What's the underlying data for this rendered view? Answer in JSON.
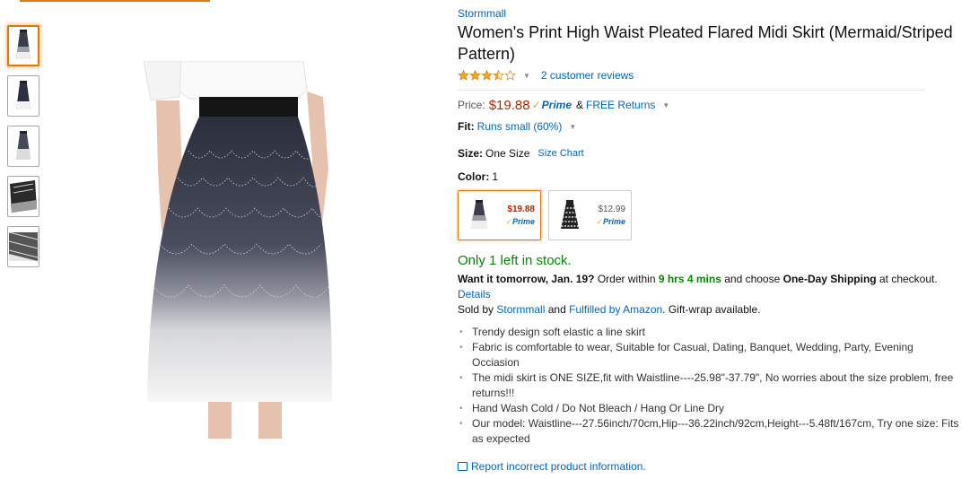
{
  "brand": "Stormmall",
  "title": "Women's Print High Waist Pleated Flared Midi Skirt (Mermaid/Striped Pattern)",
  "rating": {
    "stars": 3.5,
    "out_of": 5,
    "reviews_label": "2 customer reviews"
  },
  "price": {
    "label": "Price:",
    "value": "$19.88",
    "prime_label": "Prime",
    "amp": "&",
    "returns_label": "FREE Returns"
  },
  "fit": {
    "label": "Fit:",
    "value": "Runs small (60%)"
  },
  "size": {
    "label": "Size:",
    "value": "One Size",
    "chart_link": "Size Chart"
  },
  "color": {
    "label": "Color:",
    "value": "1"
  },
  "swatches": [
    {
      "price": "$19.88",
      "prime": "Prime",
      "selected": true
    },
    {
      "price": "$12.99",
      "prime": "Prime",
      "selected": false
    }
  ],
  "stock": "Only 1 left in stock.",
  "shipping": {
    "want_it": "Want it tomorrow, Jan. 19?",
    "order_within": "Order within",
    "time": "9 hrs 4 mins",
    "and_choose": "and choose",
    "one_day": "One-Day Shipping",
    "at_checkout": "at checkout.",
    "details_link": "Details"
  },
  "sold_by": {
    "prefix": "Sold by",
    "seller": "Stormmall",
    "and": "and",
    "fulfilled": "Fulfilled by Amazon",
    "suffix": ". Gift-wrap available."
  },
  "bullets": [
    "Trendy design soft elastic a line skirt",
    "Fabric is comfortable to wear, Suitable for Casual, Dating, Banquet, Wedding, Party, Evening Occiasion",
    "The midi skirt is ONE SIZE,fit with Waistline----25.98\"-37.79\", No worries about the size problem, free returns!!!",
    "Hand Wash Cold / Do Not Bleach / Hang Or Line Dry",
    "Our model: Waistline---27.56inch/70cm,Hip---36.22inch/92cm,Height---5.48ft/167cm, Try one size: Fits as expected"
  ],
  "report_link": "Report incorrect product information.",
  "colors": {
    "link": "#0066c0",
    "price": "#b12704",
    "stock_green": "#008a00",
    "selected_orange": "#e77600",
    "star": "#ffa41c"
  }
}
